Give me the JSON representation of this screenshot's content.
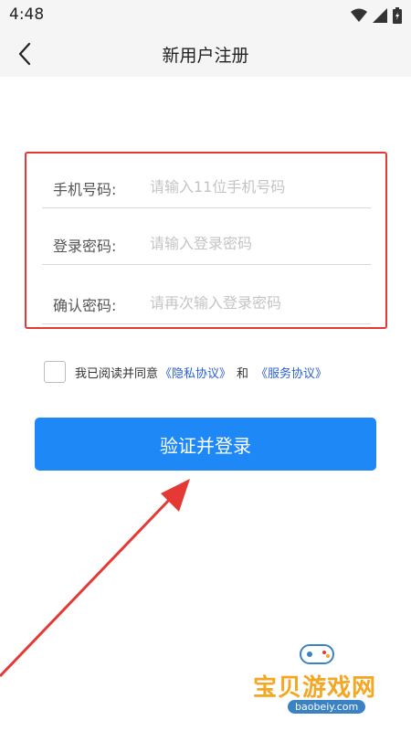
{
  "status_bar": {
    "time": "4:48"
  },
  "nav": {
    "title": "新用户注册",
    "back_icon": "chevron-left-icon"
  },
  "form": {
    "fields": [
      {
        "label": "手机号码:",
        "placeholder": "请输入11位手机号码",
        "value": ""
      },
      {
        "label": "登录密码:",
        "placeholder": "请输入登录密码",
        "value": ""
      },
      {
        "label": "确认密码:",
        "placeholder": "请再次输入登录密码",
        "value": ""
      }
    ]
  },
  "agreement": {
    "prefix": "我已阅读并同意",
    "privacy_link": "《隐私协议》",
    "and": "和",
    "service_link": "《服务协议》",
    "checked": false
  },
  "submit": {
    "label": "验证并登录"
  },
  "watermark": {
    "title": "宝贝游戏网",
    "url": "baobeiy.com"
  },
  "colors": {
    "accent": "#1e88f7",
    "highlight_border": "#e53935",
    "link": "#2a5fd6"
  }
}
